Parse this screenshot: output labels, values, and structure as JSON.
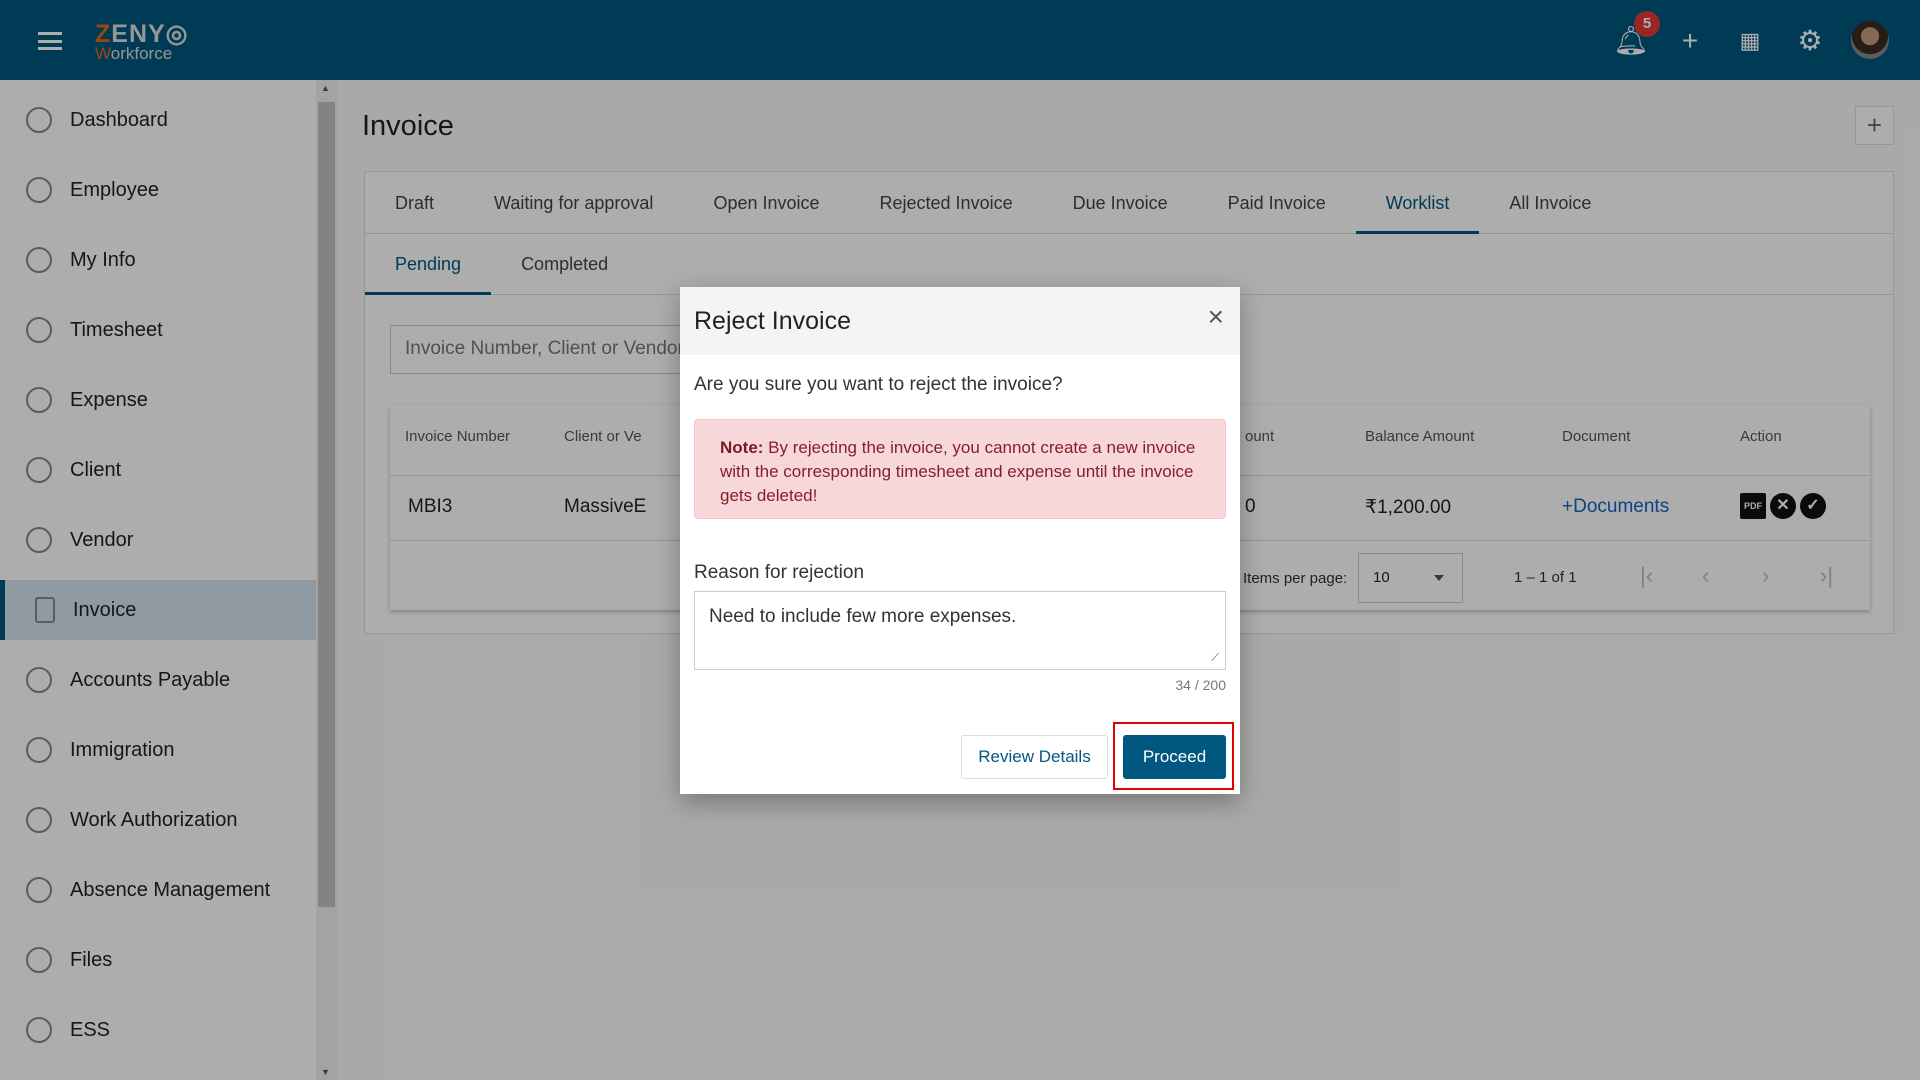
{
  "header": {
    "logo_top": "ZENYO",
    "logo_bottom": "Workforce",
    "notification_count": "5",
    "icons": [
      "menu-icon",
      "bell-icon",
      "plus-icon",
      "apps-grid-icon",
      "gear-icon",
      "avatar"
    ],
    "color": "#00577f"
  },
  "sidebar": {
    "items": [
      {
        "label": "Dashboard",
        "icon": "dashboard-icon"
      },
      {
        "label": "Employee",
        "icon": "employee-icon"
      },
      {
        "label": "My Info",
        "icon": "my-info-icon"
      },
      {
        "label": "Timesheet",
        "icon": "clock-icon"
      },
      {
        "label": "Expense",
        "icon": "expense-icon"
      },
      {
        "label": "Client",
        "icon": "client-icon"
      },
      {
        "label": "Vendor",
        "icon": "vendor-icon"
      },
      {
        "label": "Invoice",
        "icon": "invoice-icon",
        "active": true
      },
      {
        "label": "Accounts Payable",
        "icon": "accounts-payable-icon"
      },
      {
        "label": "Immigration",
        "icon": "immigration-icon"
      },
      {
        "label": "Work Authorization",
        "icon": "work-authorization-icon"
      },
      {
        "label": "Absence Management",
        "icon": "absence-icon"
      },
      {
        "label": "Files",
        "icon": "files-icon"
      },
      {
        "label": "ESS",
        "icon": "ess-icon"
      }
    ]
  },
  "page": {
    "title": "Invoice",
    "add_label": "+"
  },
  "tabs": [
    "Draft",
    "Waiting for approval",
    "Open Invoice",
    "Rejected Invoice",
    "Due Invoice",
    "Paid Invoice",
    "Worklist",
    "All Invoice"
  ],
  "active_tab": "Worklist",
  "subtabs": [
    "Pending",
    "Completed"
  ],
  "search": {
    "placeholder": "Invoice Number, Client or Vendor"
  },
  "table": {
    "headers": [
      "Invoice Number",
      "Client or Ve",
      "ount",
      "Balance Amount",
      "Document",
      "Action"
    ],
    "row": {
      "invoice_number": "MBI3",
      "client": "MassiveE",
      "amount": "0",
      "balance": "₹1,200.00",
      "document": "+Documents"
    },
    "paginator": {
      "items_per_page_label": "Items per page:",
      "items_per_page": "10",
      "range": "1 – 1 of 1"
    }
  },
  "modal": {
    "title": "Reject Invoice",
    "close": "×",
    "question": "Are you sure you want to reject the invoice?",
    "note_label": "Note:",
    "note_text": " By rejecting the invoice, you cannot create a new invoice with the corresponding timesheet and expense until the invoice gets deleted!",
    "reason_label": "Reason for rejection",
    "reason_value": "Need to include few more expenses.",
    "counter": "34 / 200",
    "review_label": "Review Details",
    "proceed_label": "Proceed"
  }
}
